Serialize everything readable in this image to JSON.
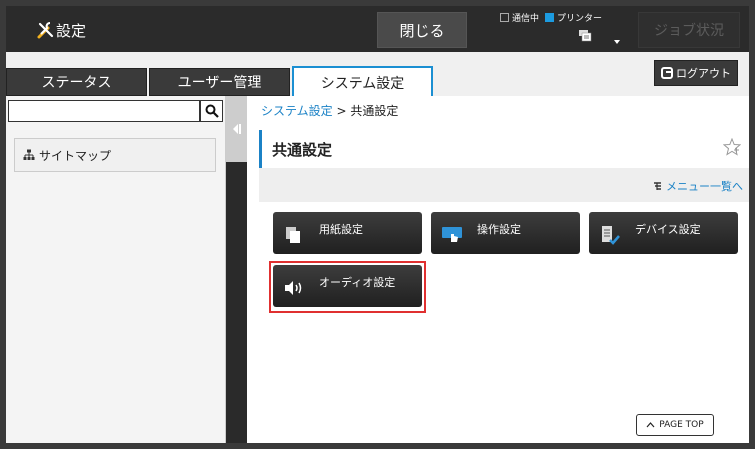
{
  "header": {
    "app_title": "設定",
    "close_label": "閉じる",
    "status_communicating": "通信中",
    "status_printer": "プリンター",
    "job_status_label": "ジョブ状況",
    "accent_color": "#1c9be0"
  },
  "tabs": [
    {
      "label": "ステータス",
      "active": false
    },
    {
      "label": "ユーザー管理",
      "active": false
    },
    {
      "label": "システム設定",
      "active": true
    }
  ],
  "logout_label": "ログアウト",
  "sidebar": {
    "search_placeholder": "",
    "sitemap_label": "サイトマップ"
  },
  "breadcrumb": {
    "parent": "システム設定",
    "separator": ">",
    "current": "共通設定"
  },
  "page_title": "共通設定",
  "menu_link": "メニュー一覧へ",
  "tiles": [
    {
      "label": "用紙設定",
      "icon": "paper-icon"
    },
    {
      "label": "操作設定",
      "icon": "touch-icon"
    },
    {
      "label": "デバイス設定",
      "icon": "device-check-icon"
    },
    {
      "label": "オーディオ設定",
      "icon": "speaker-icon",
      "highlighted": true
    }
  ],
  "page_top_label": "PAGE TOP"
}
